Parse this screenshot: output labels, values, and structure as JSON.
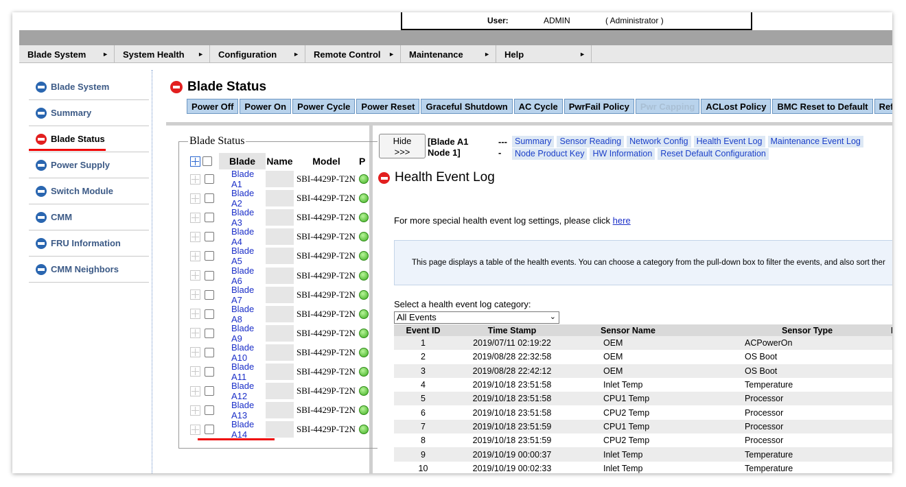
{
  "header": {
    "user_label": "User:",
    "user_name": "ADMIN",
    "user_role": "( Administrator )"
  },
  "menu": [
    {
      "label": "Blade System"
    },
    {
      "label": "System Health"
    },
    {
      "label": "Configuration"
    },
    {
      "label": "Remote Control"
    },
    {
      "label": "Maintenance"
    },
    {
      "label": "Help"
    }
  ],
  "sidebar": [
    {
      "label": "Blade System",
      "active": false
    },
    {
      "label": "Summary",
      "active": false
    },
    {
      "label": "Blade Status",
      "active": true
    },
    {
      "label": "Power Supply",
      "active": false
    },
    {
      "label": "Switch Module",
      "active": false
    },
    {
      "label": "CMM",
      "active": false
    },
    {
      "label": "FRU Information",
      "active": false
    },
    {
      "label": "CMM Neighbors",
      "active": false
    }
  ],
  "page": {
    "title": "Blade Status"
  },
  "actions": [
    {
      "label": "Power Off",
      "disabled": false
    },
    {
      "label": "Power On",
      "disabled": false
    },
    {
      "label": "Power Cycle",
      "disabled": false
    },
    {
      "label": "Power Reset",
      "disabled": false
    },
    {
      "label": "Graceful Shutdown",
      "disabled": false
    },
    {
      "label": "AC Cycle",
      "disabled": false
    },
    {
      "label": "PwrFail Policy",
      "disabled": false
    },
    {
      "label": "Pwr Capping",
      "disabled": true
    },
    {
      "label": "ACLost Policy",
      "disabled": false
    },
    {
      "label": "BMC Reset to Default",
      "disabled": false
    },
    {
      "label": "Refr",
      "disabled": false
    }
  ],
  "blade_list": {
    "legend": "Blade Status",
    "columns": {
      "blade": "Blade",
      "name": "Name",
      "model": "Model",
      "power": "P"
    },
    "rows": [
      {
        "blade": "Blade A1",
        "name": "",
        "model": "SBI-4429P-T2N"
      },
      {
        "blade": "Blade A2",
        "name": "",
        "model": "SBI-4429P-T2N"
      },
      {
        "blade": "Blade A3",
        "name": "",
        "model": "SBI-4429P-T2N"
      },
      {
        "blade": "Blade A4",
        "name": "",
        "model": "SBI-4429P-T2N"
      },
      {
        "blade": "Blade A5",
        "name": "",
        "model": "SBI-4429P-T2N"
      },
      {
        "blade": "Blade A6",
        "name": "",
        "model": "SBI-4429P-T2N"
      },
      {
        "blade": "Blade A7",
        "name": "",
        "model": "SBI-4429P-T2N"
      },
      {
        "blade": "Blade A8",
        "name": "",
        "model": "SBI-4429P-T2N"
      },
      {
        "blade": "Blade A9",
        "name": "",
        "model": "SBI-4429P-T2N"
      },
      {
        "blade": "Blade A10",
        "name": "",
        "model": "SBI-4429P-T2N"
      },
      {
        "blade": "Blade A11",
        "name": "",
        "model": "SBI-4429P-T2N"
      },
      {
        "blade": "Blade A12",
        "name": "",
        "model": "SBI-4429P-T2N"
      },
      {
        "blade": "Blade A13",
        "name": "",
        "model": "SBI-4429P-T2N"
      },
      {
        "blade": "Blade A14",
        "name": "",
        "model": "SBI-4429P-T2N"
      }
    ]
  },
  "detail": {
    "hide_line1": "Hide",
    "hide_line2": ">>>",
    "node_line1": "[Blade A1",
    "node_line2": "Node 1]",
    "dash1": "---",
    "dash2": "-",
    "links_row1": [
      {
        "label": "Summary",
        "active": false
      },
      {
        "label": "Sensor Reading",
        "active": false
      },
      {
        "label": "Network Config",
        "active": false
      },
      {
        "label": "Health Event Log",
        "active": true
      },
      {
        "label": "Maintenance Event Log",
        "active": false
      }
    ],
    "links_row2": [
      {
        "label": "Node Product Key",
        "active": false
      },
      {
        "label": "HW Information",
        "active": false
      },
      {
        "label": "Reset Default Configuration",
        "active": false
      }
    ],
    "section_title": "Health Event Log",
    "hint_text": "For more special health event log settings, please click ",
    "hint_link": "here",
    "info_text": "This page displays a table of the health events. You can choose a category from the pull-down box to filter the events, and also sort ther",
    "category_label": "Select a health event log category:",
    "category_value": "All Events"
  },
  "events": {
    "columns": {
      "id": "Event ID",
      "ts": "Time Stamp",
      "sn": "Sensor Name",
      "st": "Sensor Type",
      "d": "D"
    },
    "rows": [
      {
        "id": "1",
        "ts": "2019/07/11 02:19:22",
        "sn": "OEM",
        "st": "ACPowerOn"
      },
      {
        "id": "2",
        "ts": "2019/08/28 22:32:58",
        "sn": "OEM",
        "st": "OS Boot"
      },
      {
        "id": "3",
        "ts": "2019/08/28 22:42:12",
        "sn": "OEM",
        "st": "OS Boot"
      },
      {
        "id": "4",
        "ts": "2019/10/18 23:51:58",
        "sn": "Inlet Temp",
        "st": "Temperature"
      },
      {
        "id": "5",
        "ts": "2019/10/18 23:51:58",
        "sn": "CPU1 Temp",
        "st": "Processor"
      },
      {
        "id": "6",
        "ts": "2019/10/18 23:51:58",
        "sn": "CPU2 Temp",
        "st": "Processor"
      },
      {
        "id": "7",
        "ts": "2019/10/18 23:51:59",
        "sn": "CPU1 Temp",
        "st": "Processor"
      },
      {
        "id": "8",
        "ts": "2019/10/18 23:51:59",
        "sn": "CPU2 Temp",
        "st": "Processor"
      },
      {
        "id": "9",
        "ts": "2019/10/19 00:00:37",
        "sn": "Inlet Temp",
        "st": "Temperature"
      },
      {
        "id": "10",
        "ts": "2019/10/19 00:02:33",
        "sn": "Inlet Temp",
        "st": "Temperature"
      }
    ]
  },
  "colors": {
    "accent_red": "#e21f1f",
    "link_blue": "#1a2ec8",
    "button_blue": "#b9d3ec",
    "power_green": "#3fae21"
  }
}
